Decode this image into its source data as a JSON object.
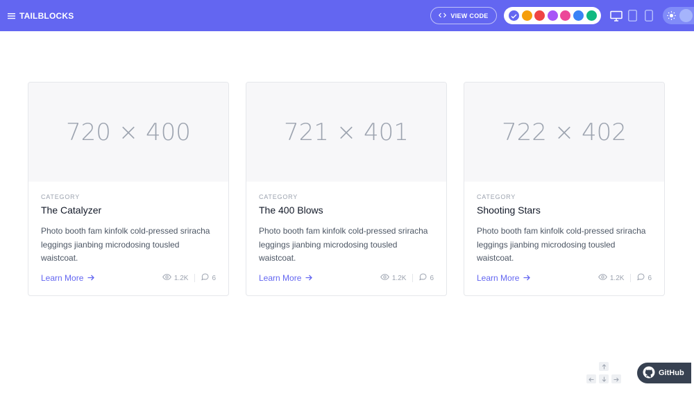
{
  "header": {
    "brand": "TAILBLOCKS",
    "view_code": "VIEW CODE",
    "palette": [
      "#6366f1",
      "#f59e0b",
      "#ef4444",
      "#a855f7",
      "#ec4899",
      "#3b82f6",
      "#10b981"
    ],
    "selected_color": "#6366f1"
  },
  "cards": [
    {
      "image_label": "720 × 400",
      "category": "CATEGORY",
      "title": "The Catalyzer",
      "description": "Photo booth fam kinfolk cold-pressed sriracha leggings jianbing microdosing tousled waistcoat.",
      "link": "Learn More",
      "views": "1.2K",
      "comments": "6"
    },
    {
      "image_label": "721 × 401",
      "category": "CATEGORY",
      "title": "The 400 Blows",
      "description": "Photo booth fam kinfolk cold-pressed sriracha leggings jianbing microdosing tousled waistcoat.",
      "link": "Learn More",
      "views": "1.2K",
      "comments": "6"
    },
    {
      "image_label": "722 × 402",
      "category": "CATEGORY",
      "title": "Shooting Stars",
      "description": "Photo booth fam kinfolk cold-pressed sriracha leggings jianbing microdosing tousled waistcoat.",
      "link": "Learn More",
      "views": "1.2K",
      "comments": "6"
    }
  ],
  "github": {
    "label": "GitHub"
  }
}
